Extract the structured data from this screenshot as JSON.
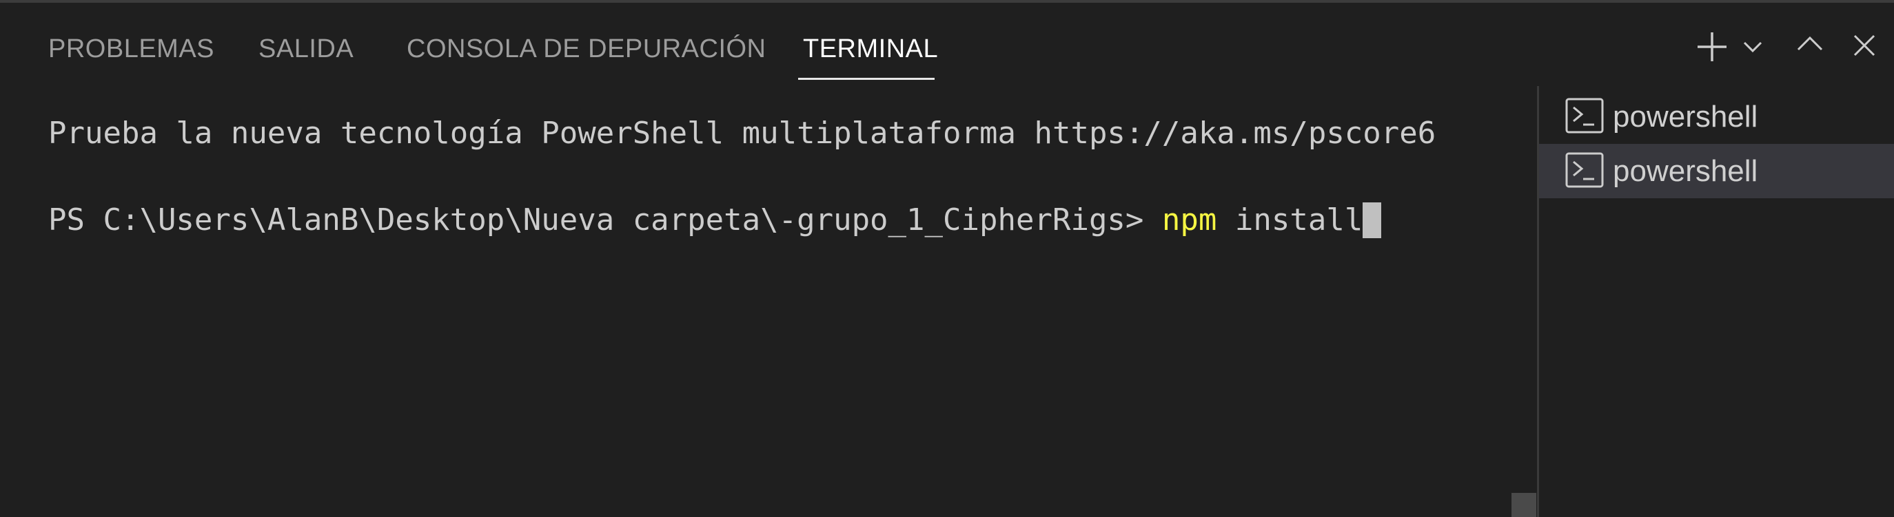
{
  "panel": {
    "tabs": [
      {
        "label": "PROBLEMAS",
        "active": false
      },
      {
        "label": "SALIDA",
        "active": false
      },
      {
        "label": "CONSOLA DE DEPURACIÓN",
        "active": false
      },
      {
        "label": "TERMINAL",
        "active": true
      }
    ],
    "actions": [
      "plus-icon",
      "chevron-down-icon",
      "chevron-up-icon",
      "close-icon"
    ]
  },
  "terminal": {
    "banner": "Prueba la nueva tecnología PowerShell multiplataforma https://aka.ms/pscore6",
    "prompt": "PS C:\\Users\\AlanB\\Desktop\\Nueva carpeta\\-grupo_1_CipherRigs> ",
    "command": "npm",
    "args": " install",
    "colors": {
      "command": "#f5f543",
      "text": "#cccccc",
      "background": "#1f1f1f"
    }
  },
  "terminal_list": [
    {
      "label": "powershell",
      "icon": "terminal-powershell-icon",
      "selected": false
    },
    {
      "label": "powershell",
      "icon": "terminal-powershell-icon",
      "selected": true
    }
  ]
}
